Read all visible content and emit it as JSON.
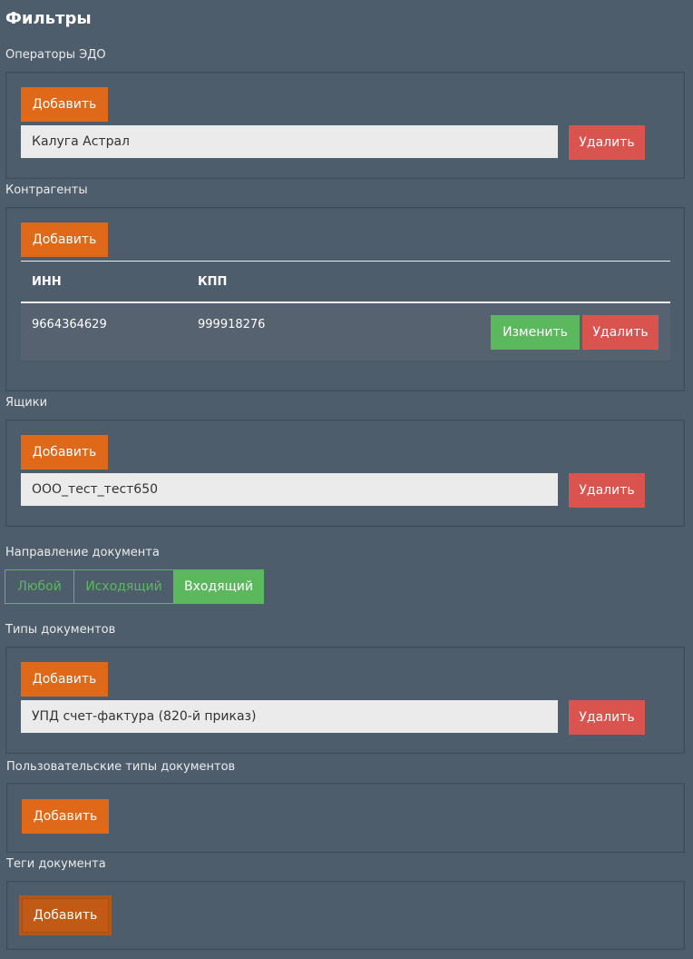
{
  "page_title": "Фильтры",
  "sections": {
    "edo_operators": {
      "label": "Операторы ЭДО",
      "add_label": "Добавить",
      "items": [
        {
          "value": "Калуга Астрал",
          "delete_label": "Удалить"
        }
      ]
    },
    "counterparties": {
      "label": "Контрагенты",
      "add_label": "Добавить",
      "columns": [
        "ИНН",
        "КПП"
      ],
      "rows": [
        {
          "inn": "9664364629",
          "kpp": "999918276",
          "edit_label": "Изменить",
          "delete_label": "Удалить"
        }
      ]
    },
    "boxes": {
      "label": "Ящики",
      "add_label": "Добавить",
      "items": [
        {
          "value": "ООО_тест_тест650",
          "delete_label": "Удалить"
        }
      ]
    },
    "direction": {
      "label": "Направление документа",
      "options": [
        "Любой",
        "Исходящий",
        "Входящий"
      ],
      "selected": "Входящий"
    },
    "doc_types": {
      "label": "Типы документов",
      "add_label": "Добавить",
      "items": [
        {
          "value": "УПД счет-фактура (820-й приказ)",
          "delete_label": "Удалить"
        }
      ]
    },
    "custom_doc_types": {
      "label": "Пользовательские типы документов",
      "add_label": "Добавить"
    },
    "doc_tags": {
      "label": "Теги документа",
      "add_label": "Добавить"
    }
  },
  "colors": {
    "background": "#4e5d6c",
    "accent_orange": "#df6919",
    "danger_red": "#d9534f",
    "success_green": "#5cb85c"
  }
}
